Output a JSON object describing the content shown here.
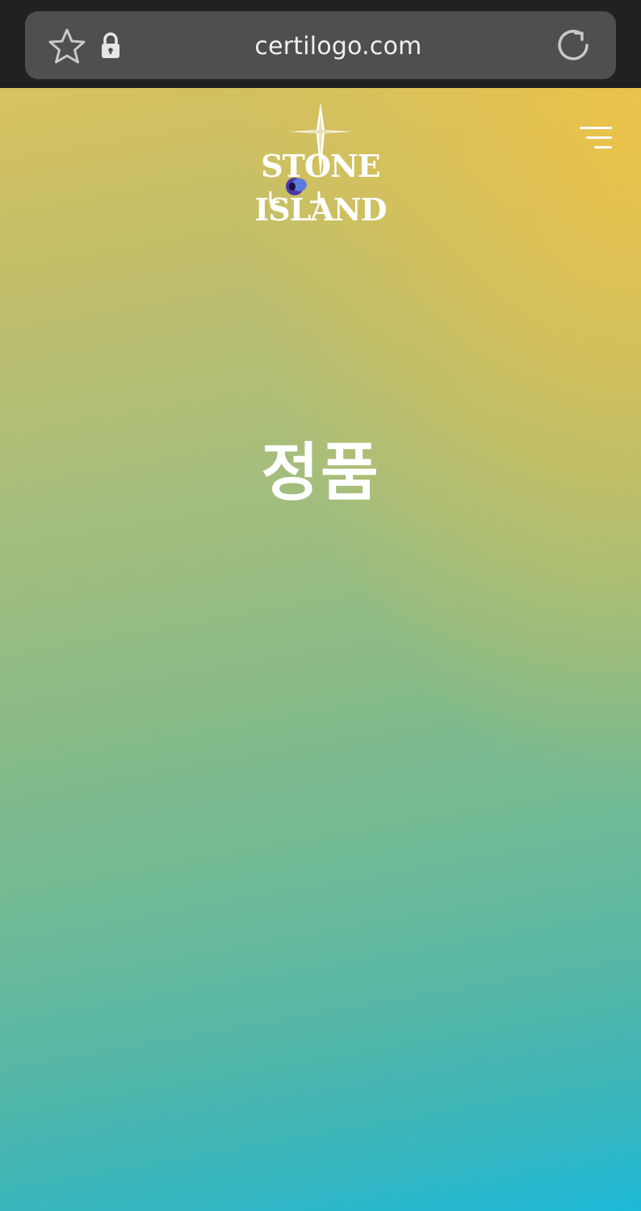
{
  "browser": {
    "url": "certilogo.com",
    "icons": {
      "favorite": "star-icon",
      "secure": "lock-icon",
      "reload": "reload-icon"
    }
  },
  "header": {
    "logo_text": "STONE ISLAND",
    "logo_icon": "compass-rose-icon",
    "menu_icon": "menu-icon"
  },
  "main": {
    "status_text": "정품"
  },
  "colors": {
    "browser_bar": "#212121",
    "address_bar": "#4f4f4f",
    "gradient_top": "#d7c25f",
    "gradient_bottom": "#1db8d8",
    "accent_corner": "#edc248",
    "text": "#ffffff"
  }
}
